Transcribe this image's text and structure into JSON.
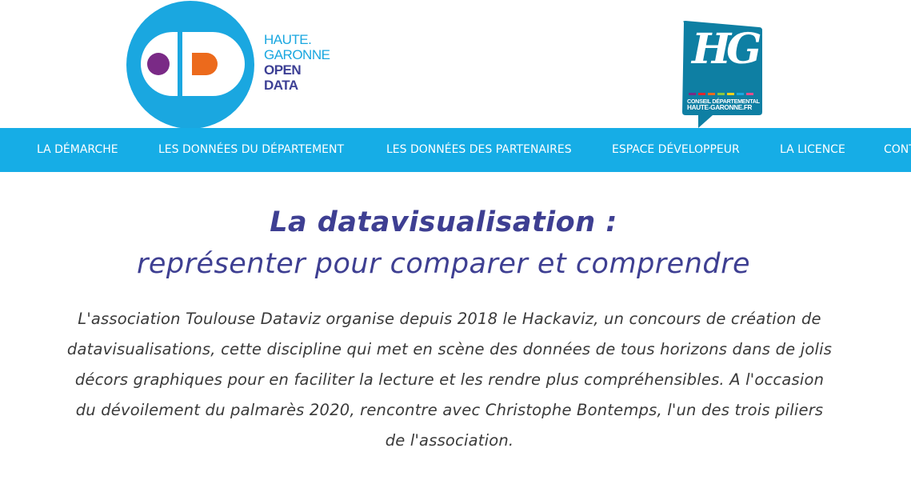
{
  "header": {
    "od_logo": {
      "line1": "HAUTE.",
      "line2": "GARONNE",
      "line3": "OPEN",
      "line4": "DATA"
    },
    "hg_logo": {
      "mark": "HG",
      "line1": "CONSEIL DÉPARTEMENTAL",
      "line2": "HAUTE-GARONNE.FR"
    }
  },
  "nav": {
    "items": [
      {
        "label": "LA DÉMARCHE"
      },
      {
        "label": "LES DONNÉES DU DÉPARTEMENT"
      },
      {
        "label": "LES DONNÉES DES PARTENAIRES"
      },
      {
        "label": "ESPACE DÉVELOPPEUR"
      },
      {
        "label": "LA LICENCE"
      },
      {
        "label": "CONTACT"
      }
    ]
  },
  "main": {
    "title_line1": "La datavisualisation :",
    "title_line2": "représenter pour comparer et comprendre",
    "intro_lines": [
      "L'association Toulouse Dataviz organise depuis 2018 le Hackaviz, un concours de création de",
      "datavisualisations, cette discipline qui met en scène des données de tous horizons dans de jolis",
      "décors graphiques pour en faciliter la lecture et les rendre plus compréhensibles. A l'occasion",
      "du dévoilement du palmarès 2020, rencontre avec Christophe Bontemps, l'un des trois piliers",
      "de l'association."
    ]
  },
  "colors": {
    "nav_background": "#16ade6",
    "logo_blue": "#1aa7e0",
    "logo_navy": "#3d4095",
    "hg_teal": "#0e7fa3",
    "title_color": "#3e3f92",
    "text_color": "#3a3a3a",
    "od_purple": "#7a2a86",
    "od_orange": "#ec6a1c"
  }
}
